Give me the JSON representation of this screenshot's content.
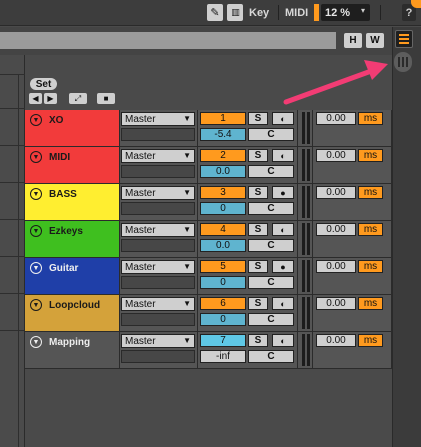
{
  "topbar": {
    "key_label": "Key",
    "midi_label": "MIDI",
    "zoom_value": "12 %",
    "help_label": "?"
  },
  "bar2": {
    "h_button": "H",
    "w_button": "W"
  },
  "set_header": {
    "label": "Set"
  },
  "tracks": [
    {
      "name": "XO",
      "color": "#f23b3b",
      "text_color": "#1a1a1a",
      "output": "Master",
      "channel": "1",
      "volume": "-5.4",
      "volume_bg": "#5fb4cf",
      "solo": "S",
      "input_icon": "clock-icon",
      "input_glyph": "◐",
      "crossfade": "C",
      "delay": "0.00",
      "unit": "ms"
    },
    {
      "name": "MIDI",
      "color": "#f23b3b",
      "text_color": "#1a1a1a",
      "output": "Master",
      "channel": "2",
      "volume": "0.0",
      "volume_bg": "#5fb4cf",
      "solo": "S",
      "input_icon": "clock-icon",
      "input_glyph": "◐",
      "crossfade": "C",
      "delay": "0.00",
      "unit": "ms"
    },
    {
      "name": "BASS",
      "color": "#ffee30",
      "text_color": "#1a1a1a",
      "output": "Master",
      "channel": "3",
      "volume": "0",
      "volume_bg": "#5fb4cf",
      "solo": "S",
      "input_icon": "dot-icon",
      "input_glyph": "●",
      "crossfade": "C",
      "delay": "0.00",
      "unit": "ms"
    },
    {
      "name": "Ezkeys",
      "color": "#3fbf1f",
      "text_color": "#1a1a1a",
      "output": "Master",
      "channel": "4",
      "volume": "0.0",
      "volume_bg": "#5fb4cf",
      "solo": "S",
      "input_icon": "clock-icon",
      "input_glyph": "◐",
      "crossfade": "C",
      "delay": "0.00",
      "unit": "ms"
    },
    {
      "name": "Guitar",
      "color": "#1f3fa8",
      "text_color": "#f0f0f0",
      "output": "Master",
      "channel": "5",
      "volume": "0",
      "volume_bg": "#5fb4cf",
      "solo": "S",
      "input_icon": "dot-icon",
      "input_glyph": "●",
      "crossfade": "C",
      "delay": "0.00",
      "unit": "ms"
    },
    {
      "name": "Loopcloud",
      "color": "#d4a23a",
      "text_color": "#1a1a1a",
      "output": "Master",
      "channel": "6",
      "volume": "0",
      "volume_bg": "#5fb4cf",
      "solo": "S",
      "input_icon": "clock-icon",
      "input_glyph": "◐",
      "crossfade": "C",
      "delay": "0.00",
      "unit": "ms"
    },
    {
      "name": "Mapping",
      "color": "#555555",
      "text_color": "#eeeeee",
      "output": "Master",
      "channel": "7",
      "volume": "-inf",
      "volume_bg": "#cfcfcf",
      "solo": "S",
      "input_icon": "clock-icon",
      "input_glyph": "◐",
      "crossfade": "C",
      "delay": "0.00",
      "unit": "ms",
      "channel_bg": "#5fc8e6"
    }
  ],
  "colors": {
    "accent_orange": "#ff9a1e",
    "annotation_arrow": "#f23c74"
  }
}
